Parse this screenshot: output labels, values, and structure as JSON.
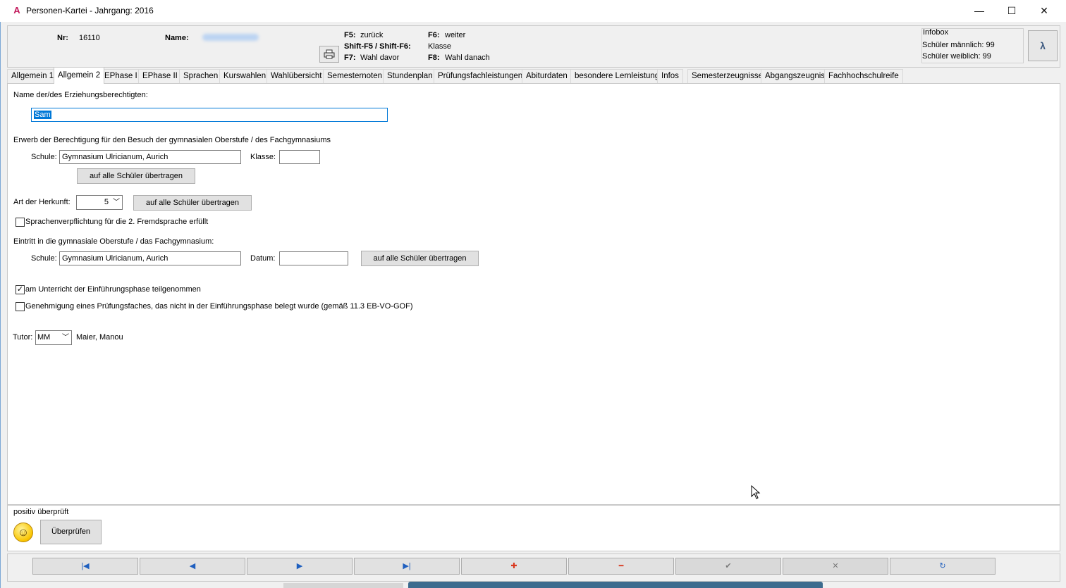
{
  "window": {
    "title": "Personen-Kartei - Jahrgang: 2016",
    "app_icon": "A",
    "controls": {
      "minimize": "—",
      "maximize": "☐",
      "close": "✕"
    }
  },
  "header": {
    "nr_label": "Nr:",
    "nr_value": "16110",
    "name_label": "Name:",
    "shortcuts": [
      {
        "key": "F5:",
        "desc": "zurück"
      },
      {
        "key": "F6:",
        "desc": "weiter"
      },
      {
        "key": "Shift-F5 / Shift-F6:",
        "desc": "Klasse"
      },
      {
        "key": "F7:",
        "desc": "Wahl davor"
      },
      {
        "key": "F8:",
        "desc": "Wahl danach"
      }
    ],
    "infobox": {
      "title": "Infobox",
      "male": "Schüler männlich: 99",
      "female": "Schüler weiblich: 99"
    }
  },
  "tabs": [
    {
      "label": "Allgemein 1"
    },
    {
      "label": "Allgemein 2",
      "active": true
    },
    {
      "label": "EPhase I"
    },
    {
      "label": "EPhase II"
    },
    {
      "label": "Sprachen"
    },
    {
      "label": "Kurswahlen"
    },
    {
      "label": "Wahlübersicht"
    },
    {
      "label": "Semesternoten"
    },
    {
      "label": "Stundenplan"
    },
    {
      "label": "Prüfungsfachleistungen"
    },
    {
      "label": "Abiturdaten"
    },
    {
      "label": "besondere Lernleistung"
    },
    {
      "label": "Infos"
    },
    {
      "label": "Semesterzeugnisse"
    },
    {
      "label": "Abgangszeugnis"
    },
    {
      "label": "Fachhochschulreife"
    }
  ],
  "form": {
    "guardian_label": "Name der/des Erziehungsberechtigten:",
    "guardian_value": "Sam",
    "berechtigung_label": "Erwerb der Berechtigung für den Besuch der gymnasialen Oberstufe / des Fachgymnasiums",
    "schule_label": "Schule:",
    "schule1_value": "Gymnasium Ulricianum, Aurich",
    "klasse_label": "Klasse:",
    "klasse_value": "",
    "transfer_label": "auf alle Schüler übertragen",
    "herkunft_label": "Art der Herkunft:",
    "herkunft_value": "5",
    "sprachen_check_label": "Sprachenverpflichtung für die 2. Fremdsprache erfüllt",
    "sprachen_checked": "",
    "eintritt_label": "Eintritt in die gymnasiale Oberstufe / das Fachgymnasium:",
    "schule2_value": "Gymnasium Ulricianum, Aurich",
    "datum_label": "Datum:",
    "datum_value": "",
    "einf_check_label": "am Unterricht der Einführungsphase teilgenommen",
    "einf_checked": "✓",
    "genehm_check_label": "Genehmigung eines Prüfungsfaches, das nicht in der Einführungsphase belegt wurde (gemäß 11.3 EB-VO-GOF)",
    "genehm_checked": "",
    "tutor_label": "Tutor:",
    "tutor_value": "MM",
    "tutor_name": "Maier, Manou"
  },
  "status": {
    "text": "positiv überprüft",
    "check_button": "Überprüfen"
  },
  "nav": {
    "first": "|◀",
    "prev": "◀",
    "next": "▶",
    "last": "▶|",
    "add": "✚",
    "remove": "━",
    "confirm": "✔",
    "cancel": "✕",
    "refresh": "↻"
  },
  "colors": {
    "nav_icons": "#1f5fbf",
    "add_remove": "#d9381e",
    "disabled": "#7a7a7a"
  }
}
